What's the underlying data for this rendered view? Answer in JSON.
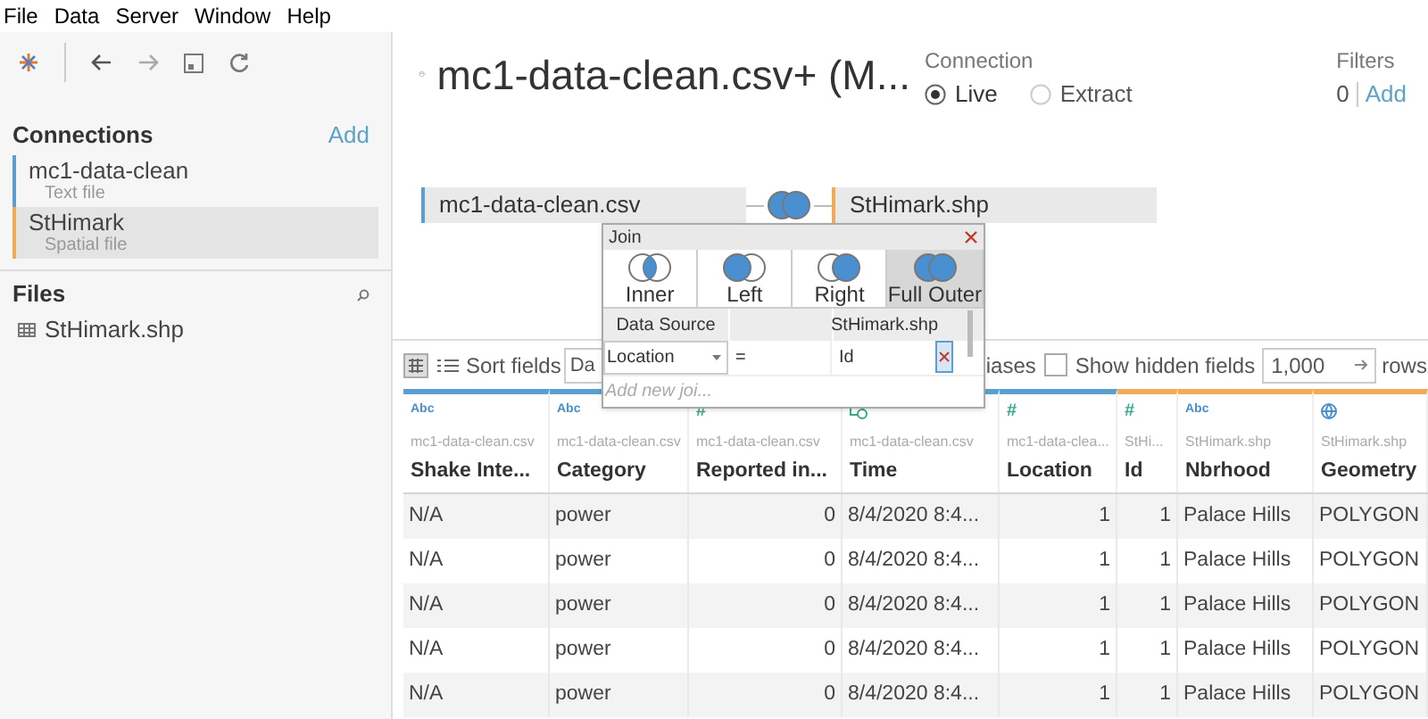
{
  "menu": [
    "File",
    "Data",
    "Server",
    "Window",
    "Help"
  ],
  "sidebar": {
    "connections_title": "Connections",
    "add_link": "Add",
    "connections": [
      {
        "name": "mc1-data-clean",
        "type": "Text file",
        "color": "#5b9fd0",
        "selected": false
      },
      {
        "name": "StHimark",
        "type": "Spatial file",
        "color": "#f2aa58",
        "selected": true
      }
    ],
    "files_title": "Files",
    "files": [
      "StHimark.shp"
    ]
  },
  "header": {
    "title": "mc1-data-clean.csv+ (M...",
    "connection": {
      "label": "Connection",
      "options": [
        {
          "label": "Live",
          "selected": true
        },
        {
          "label": "Extract",
          "selected": false
        }
      ]
    },
    "filters": {
      "label": "Filters",
      "count": "0",
      "add": "Add"
    }
  },
  "join_canvas": {
    "tables": [
      {
        "name": "mc1-data-clean.csv",
        "color": "#5b9fd0"
      },
      {
        "name": "StHimark.shp",
        "color": "#f2aa58"
      }
    ]
  },
  "join_dialog": {
    "title": "Join",
    "types": [
      {
        "label": "Inner",
        "kind": "inner",
        "selected": false
      },
      {
        "label": "Left",
        "kind": "left",
        "selected": false
      },
      {
        "label": "Right",
        "kind": "right",
        "selected": false
      },
      {
        "label": "Full Outer",
        "kind": "full",
        "selected": true
      }
    ],
    "left_heading": "Data Source",
    "right_heading": "StHimark.shp",
    "clauses": [
      {
        "left": "Location",
        "operator": "=",
        "right": "Id"
      }
    ],
    "add_placeholder": "Add new joi..."
  },
  "toolbar": {
    "sort_label": "Sort fields",
    "sort_value": "Da",
    "aliases_text": "iases",
    "show_hidden": {
      "label": "Show hidden fields",
      "checked": false
    },
    "rows_value": "1,000",
    "rows_label": "rows"
  },
  "grid": {
    "columns": [
      {
        "kind": "string",
        "type_label": "Abc",
        "source": "mc1-data-clean.csv",
        "name": "Shake Inte...",
        "color": "#5b9fd0"
      },
      {
        "kind": "string",
        "type_label": "Abc",
        "source": "mc1-data-clean.csv",
        "name": "Category",
        "color": "#5b9fd0"
      },
      {
        "kind": "number",
        "type_label": "#",
        "source": "mc1-data-clean.csv",
        "name": "Reported in..."
      },
      {
        "kind": "date",
        "source": "mc1-data-clean.csv",
        "name": "Time",
        "color": "#5b9fd0"
      },
      {
        "kind": "number",
        "type_label": "#",
        "source": "mc1-data-clea...",
        "name": "Location",
        "color": "#5b9fd0"
      },
      {
        "kind": "number",
        "type_label": "#",
        "source": "StHi...",
        "name": "Id",
        "color": "#f2aa58"
      },
      {
        "kind": "string",
        "type_label": "Abc",
        "source": "StHimark.shp",
        "name": "Nbrhood",
        "color": "#f2aa58"
      },
      {
        "kind": "geo",
        "source": "StHimark.shp",
        "name": "Geometry",
        "color": "#f2aa58"
      }
    ],
    "rows": [
      [
        "N/A",
        "power",
        "0",
        "8/4/2020 8:4...",
        "1",
        "1",
        "Palace Hills",
        "POLYGON"
      ],
      [
        "N/A",
        "power",
        "0",
        "8/4/2020 8:4...",
        "1",
        "1",
        "Palace Hills",
        "POLYGON"
      ],
      [
        "N/A",
        "power",
        "0",
        "8/4/2020 8:4...",
        "1",
        "1",
        "Palace Hills",
        "POLYGON"
      ],
      [
        "N/A",
        "power",
        "0",
        "8/4/2020 8:4...",
        "1",
        "1",
        "Palace Hills",
        "POLYGON"
      ],
      [
        "N/A",
        "power",
        "0",
        "8/4/2020 8:4...",
        "1",
        "1",
        "Palace Hills",
        "POLYGON"
      ]
    ]
  }
}
